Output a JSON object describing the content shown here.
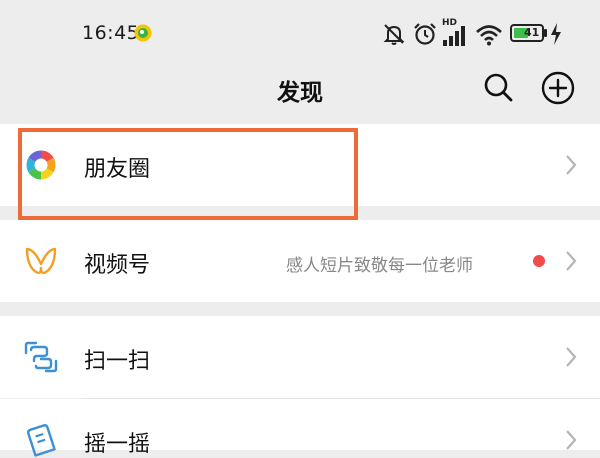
{
  "status_bar": {
    "time": "16:45",
    "hd_label": "HD",
    "battery_level": "41",
    "icons": [
      "app-notification-icon",
      "bell-muted-icon",
      "alarm-icon",
      "signal-icon",
      "wifi-icon",
      "battery-icon",
      "charging-icon"
    ]
  },
  "header": {
    "title": "发现",
    "search_icon": "search-icon",
    "add_icon": "plus-circle-icon"
  },
  "menu": {
    "moments": {
      "label": "朋友圈",
      "icon": "moments-aperture-icon"
    },
    "channels": {
      "label": "视频号",
      "subtitle": "感人短片致敬每一位老师",
      "icon": "channels-icon",
      "badge_color": "#f24b4b"
    },
    "scan": {
      "label": "扫一扫",
      "icon": "scan-icon"
    },
    "shake": {
      "label": "摇一摇",
      "icon": "shake-icon"
    }
  },
  "colors": {
    "highlight": "#ec6b38",
    "accent_blue": "#3d8fd6",
    "background": "#ededed"
  }
}
